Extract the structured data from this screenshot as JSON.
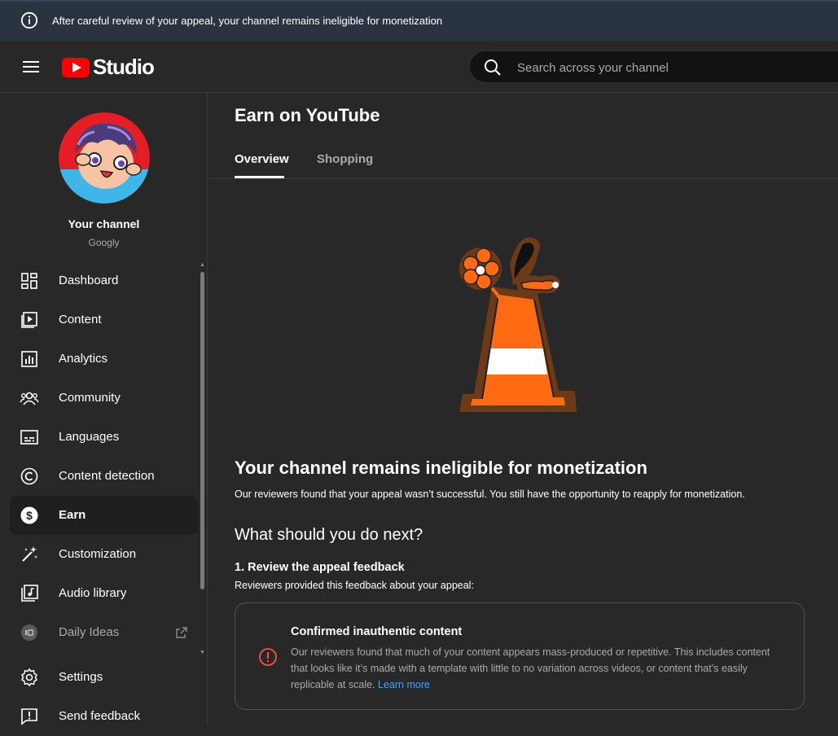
{
  "banner": {
    "icon": "info-icon",
    "text": "After careful review of your appeal, your channel remains ineligible for monetization"
  },
  "header": {
    "logo_text": "Studio",
    "search": {
      "placeholder": "Search across your channel"
    }
  },
  "channel": {
    "name": "Your channel",
    "handle": "Googly"
  },
  "sidebar": {
    "items": [
      {
        "label": "Dashboard",
        "icon": "dashboard-icon"
      },
      {
        "label": "Content",
        "icon": "content-icon"
      },
      {
        "label": "Analytics",
        "icon": "analytics-icon"
      },
      {
        "label": "Community",
        "icon": "community-icon"
      },
      {
        "label": "Languages",
        "icon": "languages-icon"
      },
      {
        "label": "Content detection",
        "icon": "copyright-icon"
      },
      {
        "label": "Earn",
        "icon": "dollar-icon",
        "active": true
      },
      {
        "label": "Customization",
        "icon": "magic-wand-icon"
      },
      {
        "label": "Audio library",
        "icon": "audio-library-icon"
      },
      {
        "label": "Daily Ideas",
        "icon": "daily-ideas-icon",
        "external": true
      }
    ],
    "footer_items": [
      {
        "label": "Settings",
        "icon": "gear-icon"
      },
      {
        "label": "Send feedback",
        "icon": "feedback-icon"
      }
    ]
  },
  "main": {
    "title": "Earn on YouTube",
    "tabs": [
      {
        "label": "Overview",
        "active": true
      },
      {
        "label": "Shopping",
        "active": false
      }
    ],
    "heading": "Your channel remains ineligible for monetization",
    "description": "Our reviewers found that your appeal wasn’t successful. You still have the opportunity to reapply for monetization.",
    "next_heading": "What should you do next?",
    "step1": {
      "title": "1. Review the appeal feedback",
      "subtitle": "Reviewers provided this feedback about your appeal:"
    },
    "feedback_card": {
      "title": "Confirmed inauthentic content",
      "body": "Our reviewers found that much of your content appears mass-produced or repetitive. This includes content that looks like it’s made with a template with little to no variation across videos, or content that’s easily replicable at scale.",
      "link": "Learn more"
    }
  },
  "colors": {
    "accent": "#3ea6ff",
    "warning": "#ff4e45",
    "brand": "#ff0000"
  }
}
